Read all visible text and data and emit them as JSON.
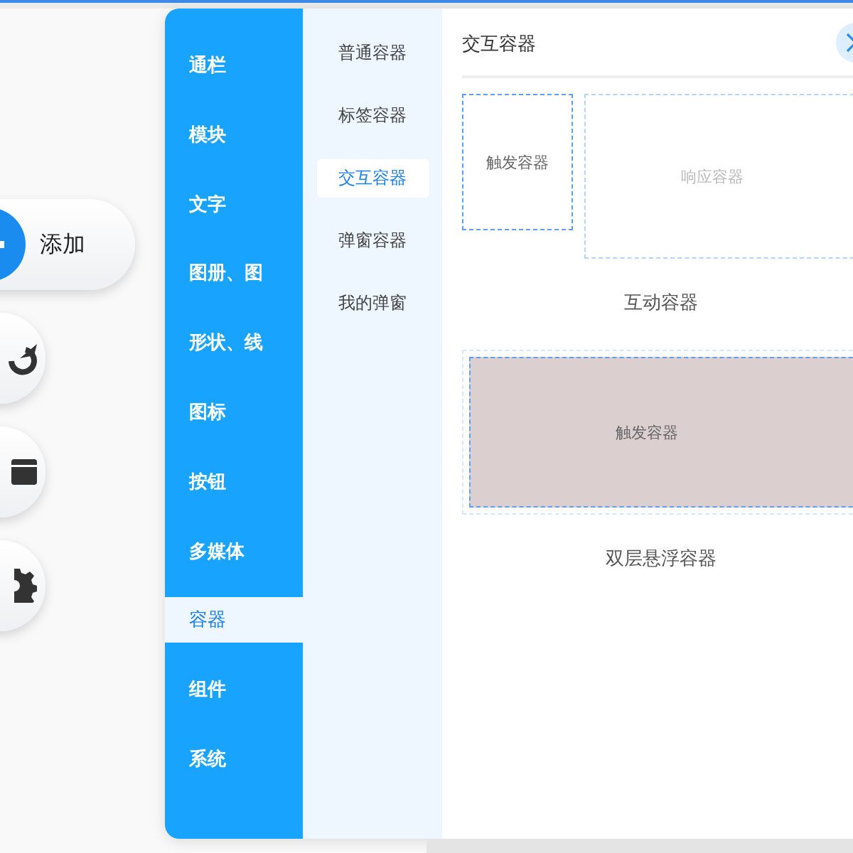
{
  "fab": {
    "label": "添加"
  },
  "categories": [
    {
      "label": "通栏",
      "selected": false
    },
    {
      "label": "模块",
      "selected": false
    },
    {
      "label": "文字",
      "selected": false
    },
    {
      "label": "图册、图",
      "selected": false
    },
    {
      "label": "形状、线",
      "selected": false
    },
    {
      "label": "图标",
      "selected": false
    },
    {
      "label": "按钮",
      "selected": false
    },
    {
      "label": "多媒体",
      "selected": false
    },
    {
      "label": "容器",
      "selected": true
    },
    {
      "label": "组件",
      "selected": false
    },
    {
      "label": "系统",
      "selected": false
    }
  ],
  "subitems": [
    {
      "label": "普通容器",
      "selected": false
    },
    {
      "label": "标签容器",
      "selected": false
    },
    {
      "label": "交互容器",
      "selected": true
    },
    {
      "label": "弹窗容器",
      "selected": false
    },
    {
      "label": "我的弹窗",
      "selected": false
    }
  ],
  "content": {
    "title": "交互容器",
    "samples": [
      {
        "kind": "interactive",
        "trigger": "触发容器",
        "response": "响应容器",
        "caption": "互动容器"
      },
      {
        "kind": "hover",
        "trigger": "触发容器",
        "caption": "双层悬浮容器"
      }
    ]
  }
}
